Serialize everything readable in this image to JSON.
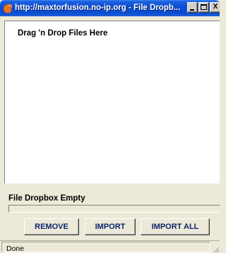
{
  "window": {
    "title": "http://maxtorfusion.no-ip.org - File Dropb...",
    "app_icon": "firefox-icon",
    "controls": [
      "minimize-icon",
      "maximize-icon",
      "close-icon"
    ],
    "close_label": "X"
  },
  "dropzone": {
    "label": "Drag 'n Drop Files Here"
  },
  "status": {
    "message": "File Dropbox Empty",
    "progress": 0
  },
  "buttons": {
    "remove": "REMOVE",
    "import": "IMPORT",
    "import_all": "IMPORT ALL"
  },
  "statusbar": {
    "text": "Done"
  },
  "colors": {
    "titlebar": "#0a4fd4",
    "button_text": "#0a246a",
    "window_bg": "#ece9d8"
  }
}
